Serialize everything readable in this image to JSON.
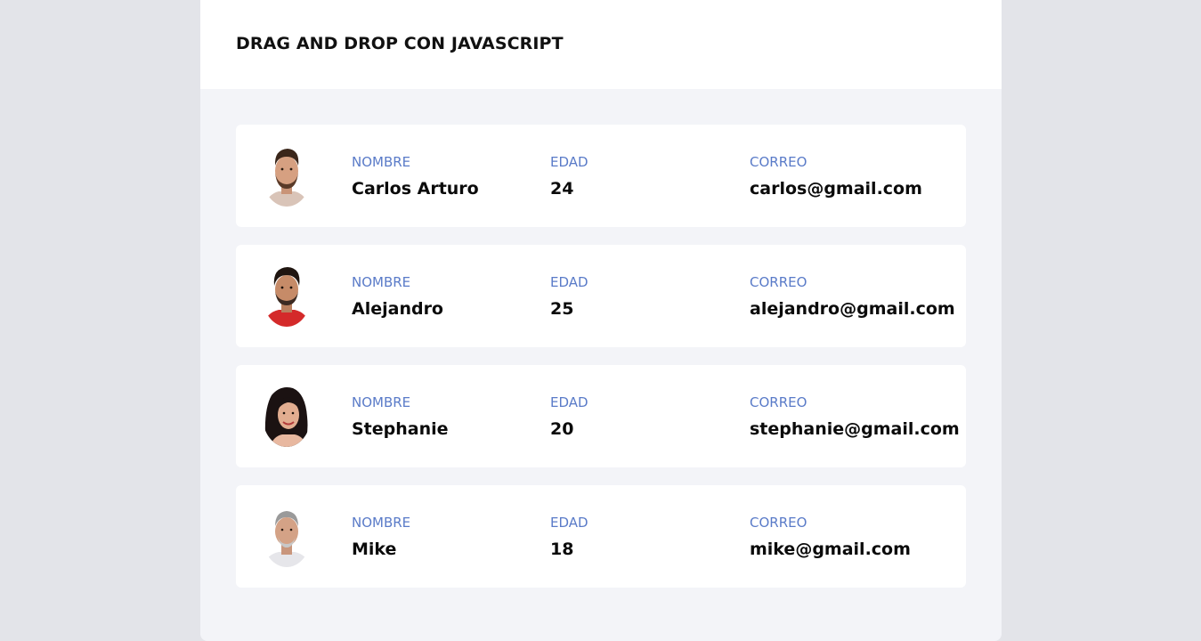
{
  "header": {
    "title": "DRAG AND DROP CON JAVASCRIPT"
  },
  "labels": {
    "nombre": "NOMBRE",
    "edad": "EDAD",
    "correo": "CORREO"
  },
  "users": [
    {
      "nombre": "Carlos Arturo",
      "edad": "24",
      "correo": "carlos@gmail.com",
      "avatar": "man-beard-avatar"
    },
    {
      "nombre": "Alejandro",
      "edad": "25",
      "correo": "alejandro@gmail.com",
      "avatar": "man-red-shirt-avatar"
    },
    {
      "nombre": "Stephanie",
      "edad": "20",
      "correo": "stephanie@gmail.com",
      "avatar": "woman-dark-hair-avatar"
    },
    {
      "nombre": "Mike",
      "edad": "18",
      "correo": "mike@gmail.com",
      "avatar": "older-man-avatar"
    }
  ]
}
